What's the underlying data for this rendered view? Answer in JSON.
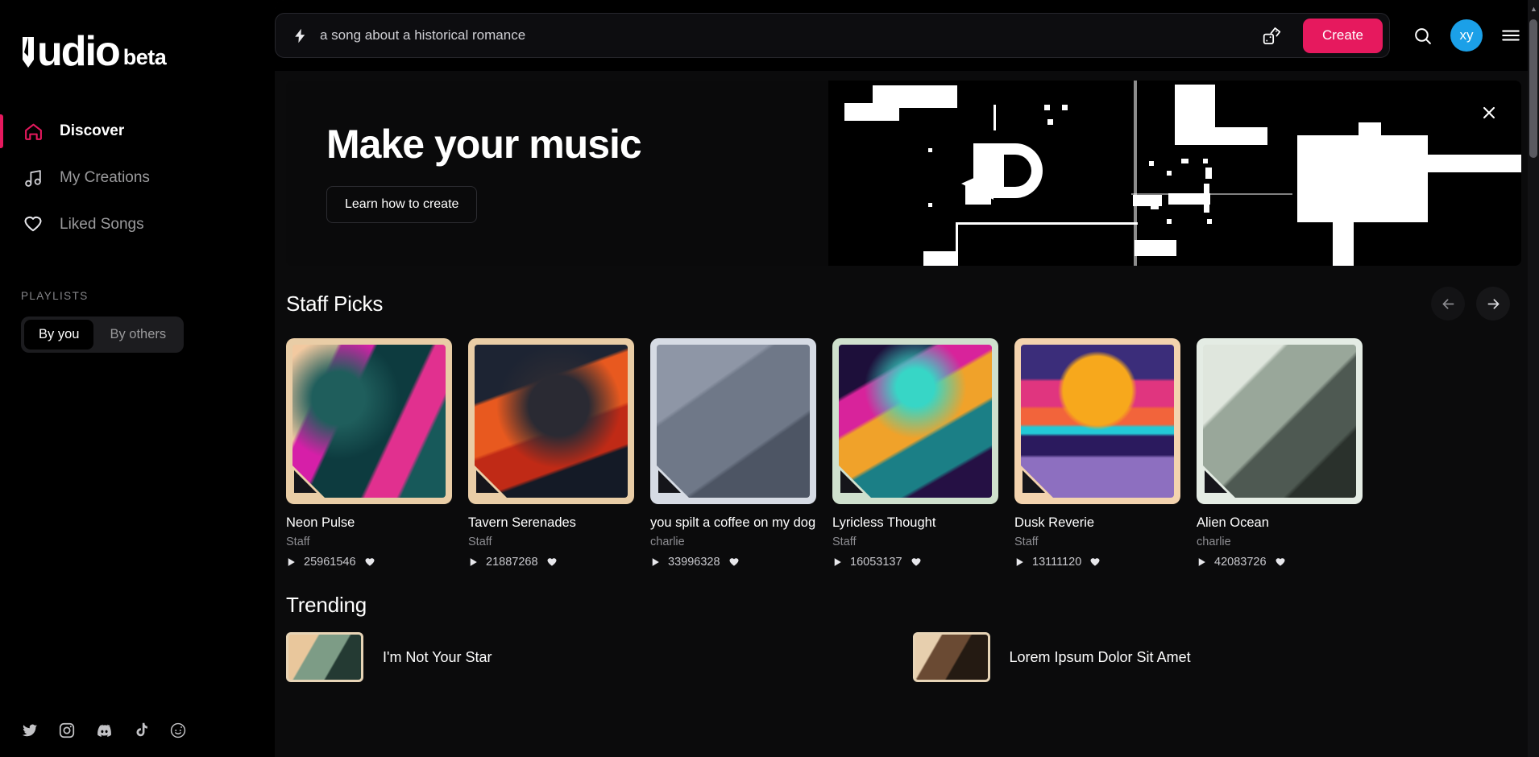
{
  "brand": {
    "name": "udio",
    "tag": "beta"
  },
  "accent": "#e6195e",
  "sidebar": {
    "nav": [
      {
        "label": "Discover",
        "icon": "home-icon",
        "active": true
      },
      {
        "label": "My Creations",
        "icon": "music-note-icon",
        "active": false
      },
      {
        "label": "Liked Songs",
        "icon": "heart-icon",
        "active": false
      }
    ],
    "playlists_label": "PLAYLISTS",
    "segments": [
      {
        "label": "By you",
        "selected": true
      },
      {
        "label": "By others",
        "selected": false
      }
    ],
    "social": [
      {
        "name": "twitter-icon"
      },
      {
        "name": "instagram-icon"
      },
      {
        "name": "discord-icon"
      },
      {
        "name": "tiktok-icon"
      },
      {
        "name": "reddit-icon"
      }
    ]
  },
  "topbar": {
    "prompt_value": "a song about a historical romance",
    "prompt_placeholder": "a song about a historical romance",
    "bolt_icon": "lightning-bolt-icon",
    "dice_icon": "dice-icon",
    "create_label": "Create",
    "search_icon": "search-icon",
    "avatar_initials": "xy",
    "avatar_color": "#1ba0e8",
    "menu_icon": "hamburger-menu-icon"
  },
  "banner": {
    "title": "Make your music",
    "cta_label": "Learn how to create",
    "close_icon": "close-icon"
  },
  "staff_picks": {
    "title": "Staff Picks",
    "prev_icon": "arrow-left-icon",
    "next_icon": "arrow-right-icon",
    "cards": [
      {
        "title": "Neon Pulse",
        "author": "Staff",
        "plays": "25961546",
        "art": "g1",
        "frame": "#e9cda6"
      },
      {
        "title": "Tavern Serenades",
        "author": "Staff",
        "plays": "21887268",
        "art": "g2",
        "frame": "#e9cda6"
      },
      {
        "title": "you spilt a coffee on my dog",
        "author": "charlie",
        "plays": "33996328",
        "art": "g3",
        "frame": "#d6dbe4"
      },
      {
        "title": "Lyricless Thought",
        "author": "Staff",
        "plays": "16053137",
        "art": "g4",
        "frame": "#cfe0cd"
      },
      {
        "title": "Dusk Reverie",
        "author": "Staff",
        "plays": "13111120",
        "art": "g5",
        "frame": "#f3d3ae"
      },
      {
        "title": "Alien Ocean",
        "author": "charlie",
        "plays": "42083726",
        "art": "g6",
        "frame": "#e4ece4"
      }
    ]
  },
  "trending": {
    "title": "Trending",
    "left": [
      {
        "title": "I'm Not Your Star",
        "art": "t1"
      }
    ],
    "right": [
      {
        "title": "Lorem Ipsum Dolor Sit Amet",
        "art": "t2"
      }
    ]
  }
}
